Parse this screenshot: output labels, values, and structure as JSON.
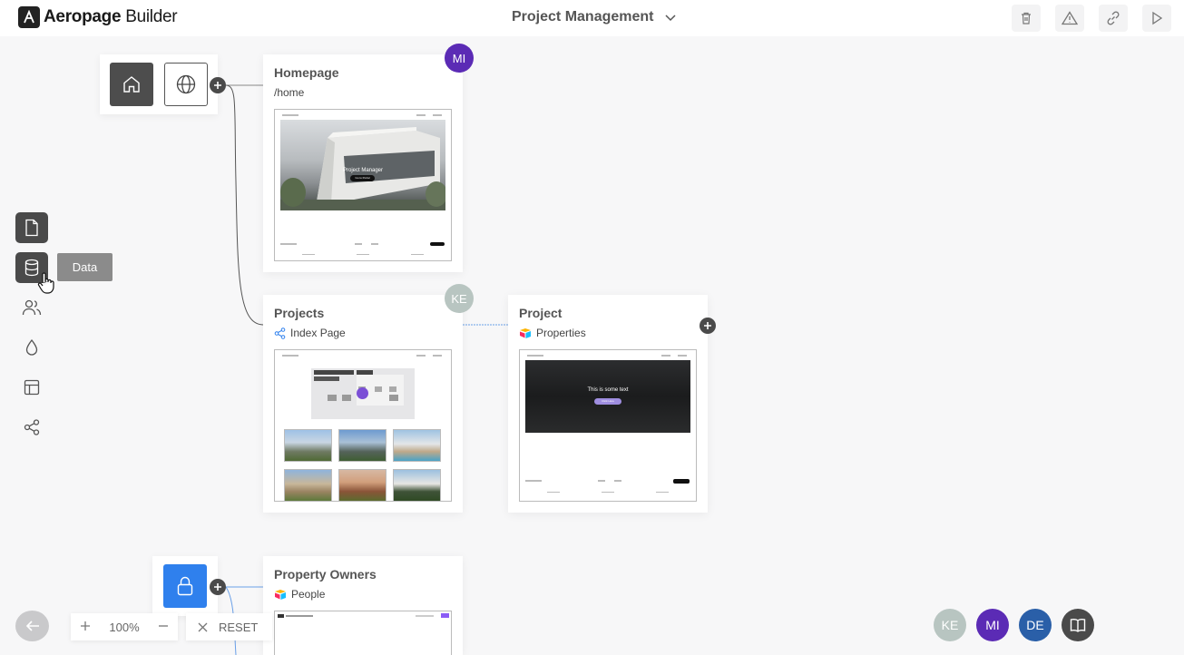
{
  "app": {
    "brand_bold": "Aeropage",
    "brand_light": "Builder"
  },
  "header": {
    "project_name": "Project Management"
  },
  "toolbar": {
    "icons": [
      "trash-icon",
      "warning-icon",
      "link-icon",
      "play-icon"
    ]
  },
  "sidebar": {
    "tooltip": "Data",
    "tools": [
      "page-icon",
      "database-icon",
      "users-icon",
      "drop-icon",
      "layout-icon",
      "share-icon"
    ]
  },
  "nodes": {
    "homepage": {
      "title": "Homepage",
      "path": "/home",
      "avatar": "MI",
      "avatar_color": "#5b2bb5",
      "thumb": {
        "hero_text": "Project Manager",
        "hero_button": "Go to Portal"
      }
    },
    "projects": {
      "title": "Projects",
      "subtitle": "Index Page",
      "avatar": "KE",
      "avatar_color": "#b8c5c1"
    },
    "project": {
      "title": "Project",
      "subtitle": "Properties",
      "thumb": {
        "hero_text": "This is some text",
        "hero_button": "Click Here"
      }
    },
    "owners": {
      "title": "Property Owners",
      "subtitle": "People"
    }
  },
  "controls": {
    "zoom": "100%",
    "reset": "RESET"
  },
  "collaborators": [
    {
      "initials": "KE",
      "color": "#b8c5c1"
    },
    {
      "initials": "MI",
      "color": "#5b2bb5"
    },
    {
      "initials": "DE",
      "color": "#2a5fa8"
    }
  ],
  "colors": {
    "accent": "#2f80ed",
    "dark": "#4a4a4a"
  }
}
